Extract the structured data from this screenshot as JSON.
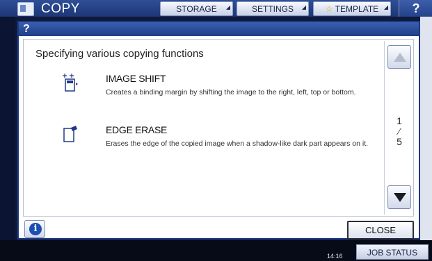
{
  "topbar": {
    "title": "COPY",
    "storage_label": "STORAGE",
    "settings_label": "SETTINGS",
    "template_label": "TEMPLATE",
    "help_label": "?"
  },
  "dialog": {
    "help_mark": "?",
    "title": "Specifying various copying functions",
    "functions": [
      {
        "icon": "image-shift-icon",
        "name": "IMAGE SHIFT",
        "description": "Creates a binding margin by shifting the image to the right, left, top or bottom."
      },
      {
        "icon": "edge-erase-icon",
        "name": "EDGE ERASE",
        "description": "Erases the edge of the copied image when a shadow-like dark part appears on it."
      }
    ],
    "page": {
      "current": "1",
      "total": "5"
    },
    "close_label": "CLOSE"
  },
  "footer": {
    "clock": "14:16",
    "job_status_label": "JOB STATUS"
  },
  "colors": {
    "header_blue": "#1f3e87",
    "info_blue": "#1b4fb0"
  }
}
